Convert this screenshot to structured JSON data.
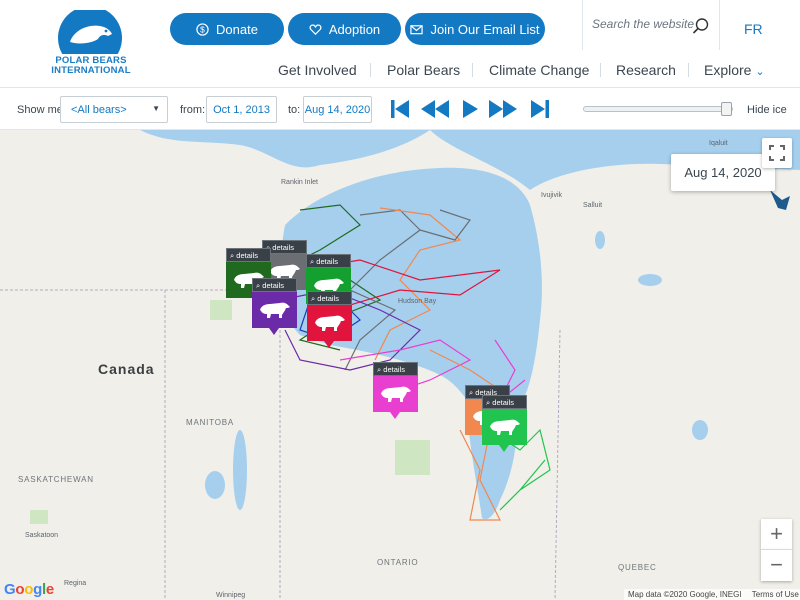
{
  "header": {
    "logo_text": [
      "POLAR BEARS",
      "INTERNATIONAL"
    ],
    "buttons": {
      "donate": "Donate",
      "adoption": "Adoption",
      "email": "Join Our Email List"
    },
    "search_placeholder": "Search the website",
    "lang": "FR",
    "nav": [
      "Get Involved",
      "Polar Bears",
      "Climate Change",
      "Research",
      "Explore"
    ]
  },
  "controls": {
    "show_me_label": "Show me",
    "bear_select": "<All bears>",
    "from_label": "from:",
    "from_date": "Oct 1, 2013",
    "to_label": "to:",
    "to_date": "Aug 14, 2020",
    "hide_ice": "Hide ice",
    "slider_value_fraction": 0.95
  },
  "map": {
    "current_date": "Aug 14, 2020",
    "places": {
      "rankin": "Rankin Inlet",
      "iqaluit": "Iqaluit",
      "ivujivik": "Ivujivik",
      "salluit": "Salluit",
      "hudson_bay": "Hudson Bay",
      "canada": "Canada",
      "manitoba": "MANITOBA",
      "saskatchewan": "SASKATCHEWAN",
      "saskatoon": "Saskatoon",
      "regina": "Regina",
      "winnipeg": "Winnipeg",
      "ontario": "ONTARIO",
      "quebec": "QUEBEC"
    },
    "attribution": "Map data ©2020 Google, INEGI",
    "terms": "Terms of Use",
    "google_logo": "Google",
    "zoom_in": "+",
    "zoom_out": "−"
  },
  "bears": {
    "detail_label": "details",
    "colors": {
      "green": "#1f6a1f",
      "gray": "#6b6f73",
      "bright_green": "#14a02f",
      "purple": "#6b2aa8",
      "red": "#e0143c",
      "pink": "#e83fd0",
      "orange": "#f08850",
      "lime": "#21c44e"
    }
  },
  "colors": {
    "brand_blue": "#1479c3",
    "water": "#a6cfee",
    "land": "#f1efe9"
  }
}
